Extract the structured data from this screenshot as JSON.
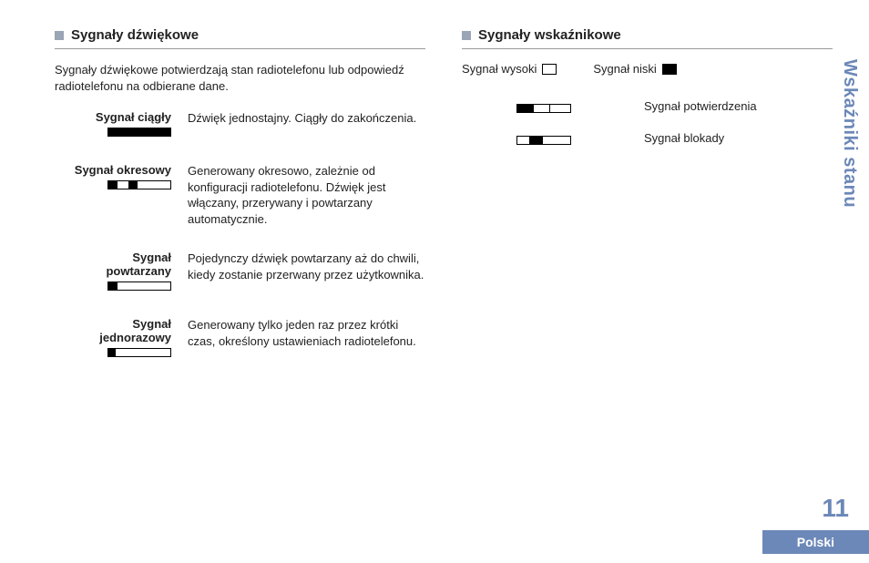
{
  "side_tab": "Wskaźniki stanu",
  "page_number": "11",
  "lang_tab": "Polski",
  "left": {
    "heading": "Sygnały dźwiękowe",
    "intro": "Sygnały dźwiękowe potwierdzają stan radiotelefonu lub odpowiedź radiotelefonu na odbierane dane.",
    "rows": [
      {
        "label": "Sygnał ciągły",
        "desc": "Dźwięk jednostajny. Ciągły do zakończenia."
      },
      {
        "label": "Sygnał okresowy",
        "desc": "Generowany okresowo, zależnie od konfiguracji radiotelefonu. Dźwięk jest włączany, przerywany i powtarzany automatycznie."
      },
      {
        "label": "Sygnał powtarzany",
        "desc": "Pojedynczy dźwięk powtarzany aż do chwili, kiedy zostanie przerwany przez użytkownika."
      },
      {
        "label": "Sygnał jednorazowy",
        "desc": "Generowany tylko jeden raz przez krótki czas, określony ustawieniach radiotelefonu."
      }
    ]
  },
  "right": {
    "heading": "Sygnały wskaźnikowe",
    "legend": {
      "high": "Sygnał wysoki",
      "low": "Sygnał niski"
    },
    "rows": [
      {
        "label": "Sygnał potwierdzenia"
      },
      {
        "label": "Sygnał blokady"
      }
    ]
  }
}
